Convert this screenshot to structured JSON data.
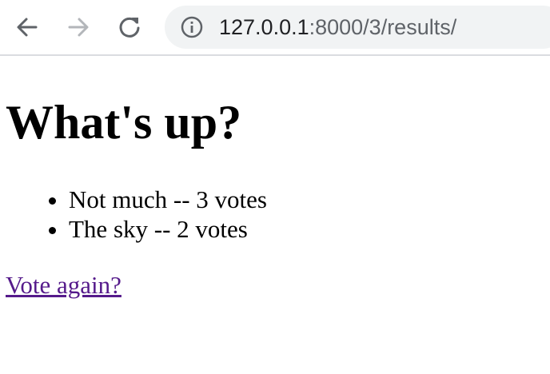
{
  "browser": {
    "url_host": "127.0.0.1",
    "url_path": ":8000/3/results/",
    "icons": {
      "back": "back-arrow-icon",
      "forward": "forward-arrow-icon",
      "reload": "reload-icon",
      "info": "info-icon"
    }
  },
  "page": {
    "title": "What's up?",
    "choices": [
      {
        "text": "Not much -- 3 votes"
      },
      {
        "text": "The sky -- 2 votes"
      }
    ],
    "vote_again_label": "Vote again?",
    "link_color": "#551a8b"
  }
}
